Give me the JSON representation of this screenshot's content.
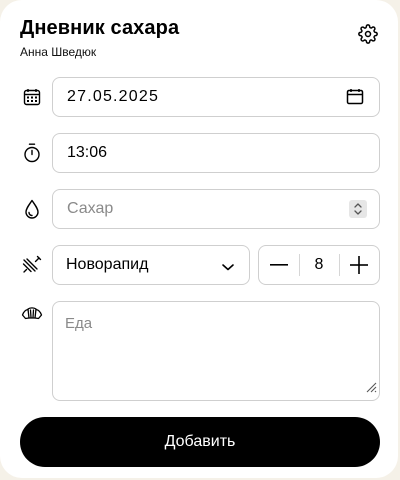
{
  "header": {
    "title": "Дневник сахара",
    "user_name": "Анна Шведюк",
    "settings_icon": "gear-icon"
  },
  "form": {
    "date": {
      "icon": "calendar-icon",
      "value": "27.05.2025",
      "picker_icon": "calendar-icon"
    },
    "time": {
      "icon": "stopwatch-icon",
      "value": "13:06"
    },
    "sugar": {
      "icon": "drop-icon",
      "placeholder": "Сахар"
    },
    "insulin": {
      "icon": "syringe-icon",
      "type": "Новорапид",
      "dose": "8",
      "minus_label": "−",
      "plus_label": "+"
    },
    "food": {
      "icon": "croissant-icon",
      "placeholder": "Еда"
    },
    "submit_label": "Добавить"
  },
  "colors": {
    "card": "#ffffff",
    "background": "#f5f1e8",
    "border": "#cfcfcf",
    "button": "#000000",
    "button_text": "#ffffff",
    "placeholder": "#8a8a8a"
  }
}
